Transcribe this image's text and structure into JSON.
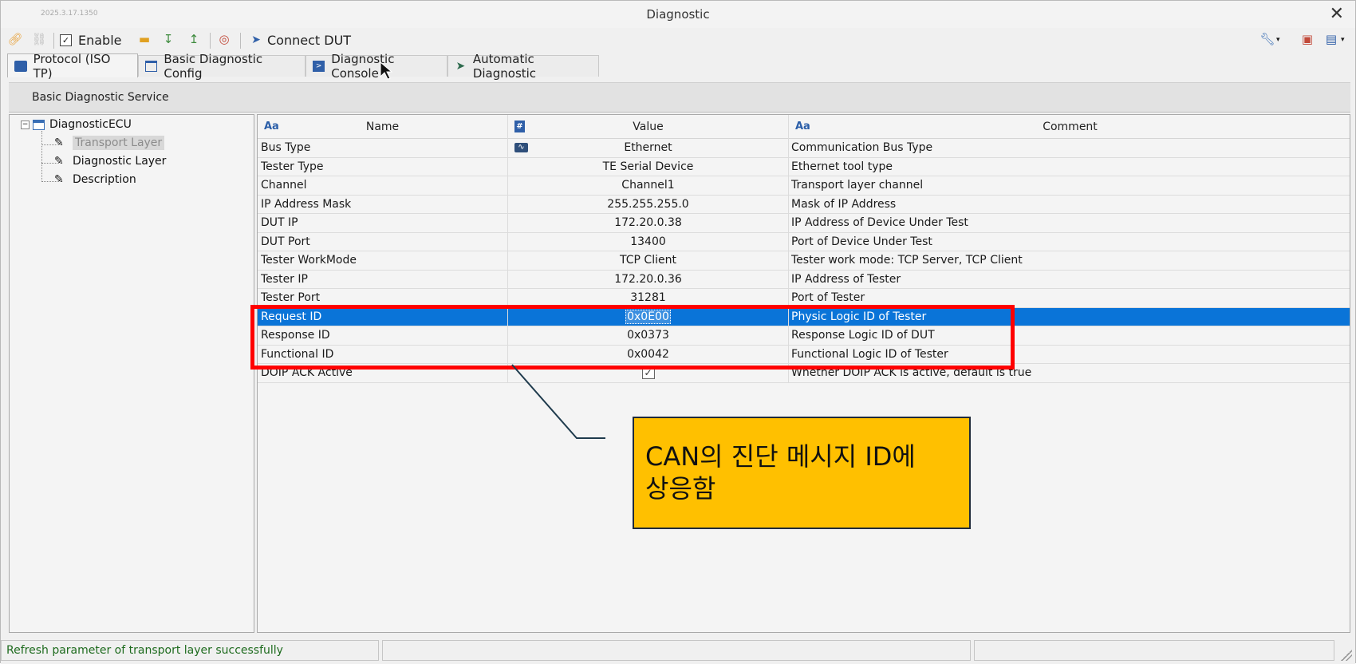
{
  "window": {
    "version": "2025.3.17.1350",
    "title": "Diagnostic",
    "close_glyph": "✕"
  },
  "toolbar": {
    "enable_label": "Enable",
    "enable_checked": true,
    "connect_label": "Connect DUT",
    "icons": [
      "link-icon",
      "unlink-icon",
      "open-folder-icon",
      "import-icon",
      "export-icon",
      "diagnose-icon",
      "cursor-icon",
      "wrench-icon",
      "window-close-icon",
      "window-layout-icon"
    ]
  },
  "tabs": [
    {
      "label": "Protocol (ISO TP)",
      "active": true
    },
    {
      "label": "Basic Diagnostic Config",
      "active": false
    },
    {
      "label": "Diagnostic Console",
      "active": false
    },
    {
      "label": "Automatic Diagnostic",
      "active": false
    }
  ],
  "service_bar": {
    "label": "Basic Diagnostic Service"
  },
  "tree": {
    "root": "DiagnosticECU",
    "children": [
      "Transport Layer",
      "Diagnostic Layer",
      "Description"
    ],
    "selected": "Transport Layer"
  },
  "grid": {
    "columns": {
      "name": "Name",
      "value": "Value",
      "comment": "Comment",
      "name_type": "Aa",
      "value_type": "#",
      "comment_type": "Aa"
    },
    "rows": [
      {
        "name": "Bus Type",
        "value": "Ethernet",
        "comment": "Communication Bus Type"
      },
      {
        "name": "Tester Type",
        "value": "TE Serial Device",
        "comment": "Ethernet tool type"
      },
      {
        "name": "Channel",
        "value": "Channel1",
        "comment": "Transport layer channel"
      },
      {
        "name": "IP Address Mask",
        "value": "255.255.255.0",
        "comment": "Mask of IP Address"
      },
      {
        "name": "DUT IP",
        "value": "172.20.0.38",
        "comment": "IP Address of Device Under Test"
      },
      {
        "name": "DUT Port",
        "value": "13400",
        "comment": "Port of Device Under Test"
      },
      {
        "name": "Tester WorkMode",
        "value": "TCP Client",
        "comment": "Tester work mode: TCP Server, TCP Client"
      },
      {
        "name": "Tester IP",
        "value": "172.20.0.36",
        "comment": "IP Address of Tester"
      },
      {
        "name": "Tester Port",
        "value": "31281",
        "comment": "Port of Tester"
      },
      {
        "name": "Request ID",
        "value": "0x0E00",
        "comment": "Physic Logic ID of Tester"
      },
      {
        "name": "Response ID",
        "value": "0x0373",
        "comment": "Response Logic ID of DUT"
      },
      {
        "name": "Functional ID",
        "value": "0x0042",
        "comment": "Functional Logic ID of Tester"
      },
      {
        "name": "DOIP ACK Active",
        "value": "",
        "comment": "Whether DOIP ACK is active, default is true"
      }
    ],
    "selected_row": 9,
    "doip_ack_checked": true
  },
  "annotation": {
    "callout_line1": "CAN의 진단 메시지 ID에",
    "callout_line2": "상응함",
    "highlight_color": "#ff0000",
    "callout_color": "#ffc000"
  },
  "status": {
    "message": "Refresh parameter of transport layer successfully"
  }
}
